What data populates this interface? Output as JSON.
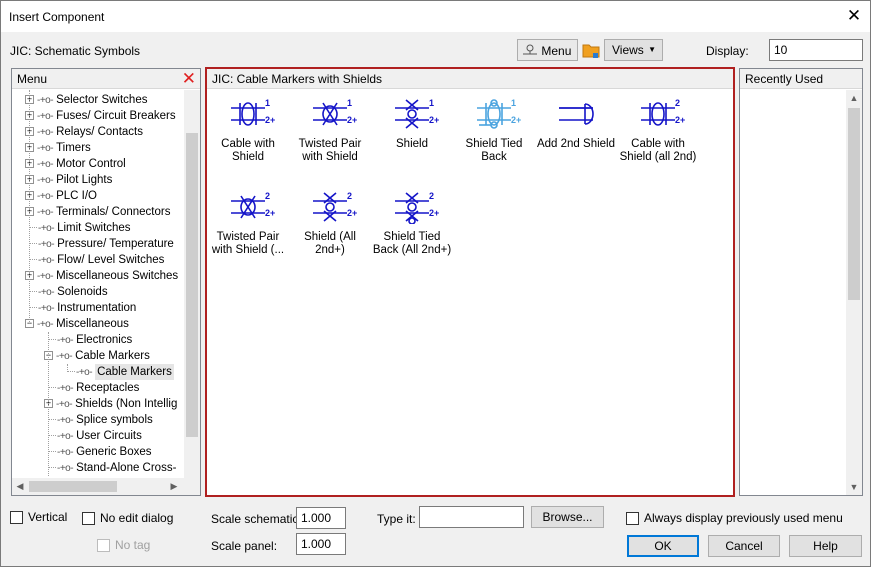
{
  "window": {
    "title": "Insert Component"
  },
  "header": {
    "library": "JIC: Schematic Symbols",
    "menu_button": "Menu",
    "views_button": "Views",
    "display_label": "Display:",
    "display_value": "10"
  },
  "left_panel": {
    "title": "Menu",
    "items": [
      {
        "label": "Selector Switches",
        "level": 0,
        "expander": "+"
      },
      {
        "label": "Fuses/ Circuit Breakers",
        "level": 0,
        "expander": "+"
      },
      {
        "label": "Relays/ Contacts",
        "level": 0,
        "expander": "+"
      },
      {
        "label": "Timers",
        "level": 0,
        "expander": "+"
      },
      {
        "label": "Motor Control",
        "level": 0,
        "expander": "+"
      },
      {
        "label": "Pilot Lights",
        "level": 0,
        "expander": "+"
      },
      {
        "label": "PLC I/O",
        "level": 0,
        "expander": "+"
      },
      {
        "label": "Terminals/ Connectors",
        "level": 0,
        "expander": "+"
      },
      {
        "label": "Limit Switches",
        "level": 0,
        "expander": ""
      },
      {
        "label": "Pressure/ Temperature",
        "level": 0,
        "expander": ""
      },
      {
        "label": "Flow/ Level Switches",
        "level": 0,
        "expander": ""
      },
      {
        "label": "Miscellaneous Switches",
        "level": 0,
        "expander": "+"
      },
      {
        "label": "Solenoids",
        "level": 0,
        "expander": ""
      },
      {
        "label": "Instrumentation",
        "level": 0,
        "expander": ""
      },
      {
        "label": "Miscellaneous",
        "level": 0,
        "expander": "−"
      },
      {
        "label": "Electronics",
        "level": 1,
        "expander": ""
      },
      {
        "label": "Cable Markers",
        "level": 1,
        "expander": "−"
      },
      {
        "label": "Cable Markers",
        "level": 2,
        "expander": "",
        "selected": true
      },
      {
        "label": "Receptacles",
        "level": 1,
        "expander": ""
      },
      {
        "label": "Shields (Non Intellig",
        "level": 1,
        "expander": "+"
      },
      {
        "label": "Splice symbols",
        "level": 1,
        "expander": ""
      },
      {
        "label": "User Circuits",
        "level": 1,
        "expander": ""
      },
      {
        "label": "Generic Boxes",
        "level": 1,
        "expander": ""
      },
      {
        "label": "Stand-Alone Cross-",
        "level": 1,
        "expander": ""
      }
    ]
  },
  "center_panel": {
    "title": "JIC: Cable Markers with Shields",
    "symbols": [
      {
        "caption1": "Cable with",
        "caption2": "Shield",
        "kind": "cable",
        "nums": [
          "1",
          "2+"
        ]
      },
      {
        "caption1": "Twisted Pair",
        "caption2": "with Shield",
        "kind": "twisted",
        "nums": [
          "1",
          "2+"
        ]
      },
      {
        "caption1": "Shield",
        "caption2": "",
        "kind": "shield",
        "nums": [
          "1",
          "2+"
        ]
      },
      {
        "caption1": "Shield Tied",
        "caption2": "Back",
        "kind": "tied",
        "nums": [
          "1",
          "2+"
        ]
      },
      {
        "caption1": "Add 2nd Shield",
        "caption2": "",
        "kind": "add2",
        "nums": [
          "",
          ""
        ]
      },
      {
        "caption1": "Cable with",
        "caption2": "Shield (all 2nd)",
        "kind": "cable",
        "nums": [
          "2",
          "2+"
        ]
      },
      {
        "caption1": "Twisted Pair",
        "caption2": "with Shield (...",
        "kind": "twisted",
        "nums": [
          "2",
          "2+"
        ]
      },
      {
        "caption1": "Shield (All 2nd+)",
        "caption2": "",
        "kind": "shield",
        "nums": [
          "2",
          "2+"
        ]
      },
      {
        "caption1": "Shield Tied",
        "caption2": "Back (All 2nd+)",
        "kind": "shieldtied2",
        "nums": [
          "2",
          "2+"
        ]
      }
    ],
    "colors": {
      "symbol": "#1414c8",
      "symbol_light": "#4aa3df",
      "highlight_border": "#b02020"
    }
  },
  "right_panel": {
    "title": "Recently Used"
  },
  "footer": {
    "vertical": "Vertical",
    "no_edit_dialog": "No edit dialog",
    "no_tag": "No tag",
    "scale_schematic_label": "Scale schematic:",
    "scale_schematic_value": "1.000",
    "scale_panel_label": "Scale panel:",
    "scale_panel_value": "1.000",
    "type_it_label": "Type it:",
    "type_it_value": "",
    "browse_button": "Browse...",
    "always_display": "Always display previously used menu",
    "ok_button": "OK",
    "cancel_button": "Cancel",
    "help_button": "Help"
  }
}
